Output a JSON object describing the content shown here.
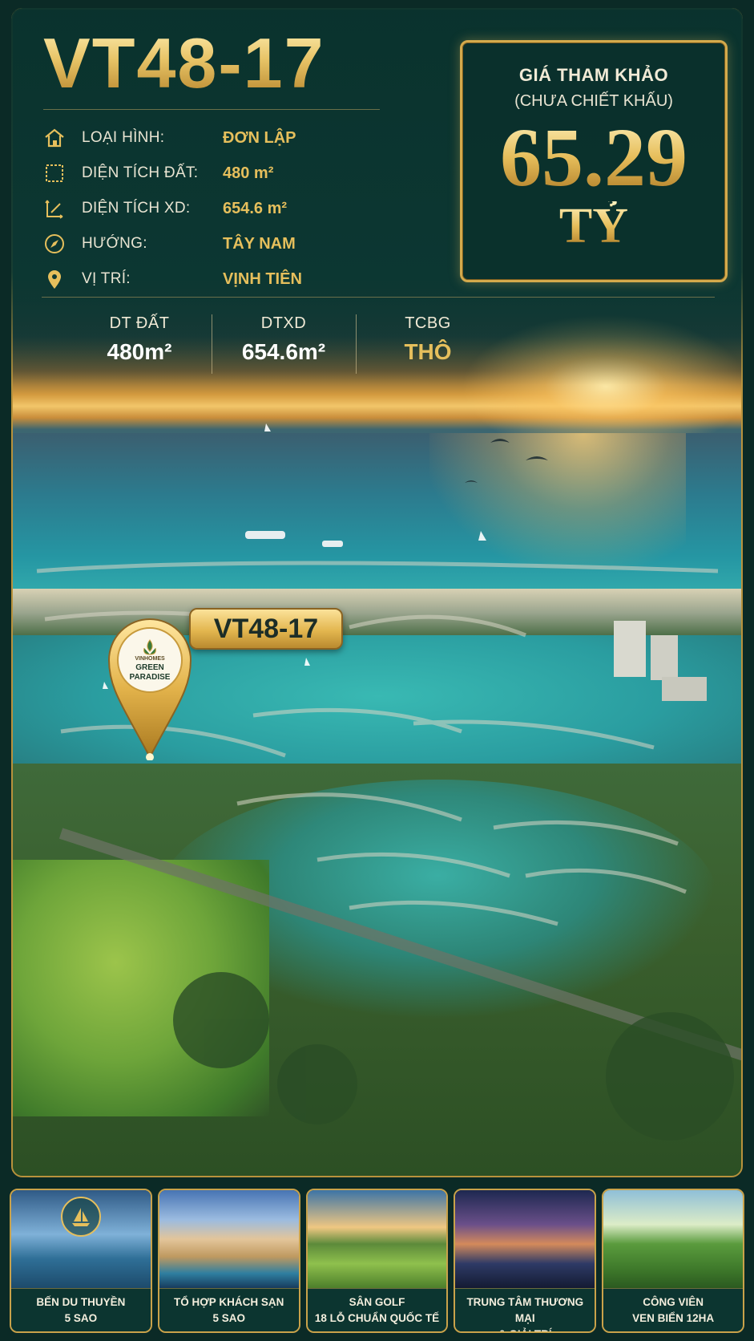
{
  "lot_code": "VT48-17",
  "specs": [
    {
      "icon": "house-icon",
      "label": "LOẠI HÌNH:",
      "value": "ĐƠN LẬP"
    },
    {
      "icon": "land-area-icon",
      "label": "DIỆN TÍCH ĐẤT:",
      "value": "480 m²"
    },
    {
      "icon": "floor-area-icon",
      "label": "DIỆN TÍCH XD:",
      "value": "654.6 m²"
    },
    {
      "icon": "compass-icon",
      "label": "HƯỚNG:",
      "value": "TÂY NAM"
    },
    {
      "icon": "location-pin-icon",
      "label": "VỊ TRÍ:",
      "value": "VỊNH TIÊN"
    }
  ],
  "price": {
    "label": "GIÁ THAM KHẢO",
    "note": "(CHƯA CHIẾT KHẤU)",
    "value": "65.29",
    "unit": "TỶ"
  },
  "stats": [
    {
      "label": "DT ĐẤT",
      "value": "480m²"
    },
    {
      "label": "DTXD",
      "value": "654.6m²"
    },
    {
      "label": "TCBG",
      "value": "THÔ"
    }
  ],
  "map": {
    "pin_logo_top": "VINHOMES",
    "pin_logo_line1": "GREEN",
    "pin_logo_line2": "PARADISE",
    "lot_label": "VT48-17"
  },
  "amenities": [
    {
      "line1": "BẾN DU THUYỀN",
      "line2": "5 SAO",
      "icon": "sailboat-icon"
    },
    {
      "line1": "TỔ HỢP KHÁCH SẠN",
      "line2": "5 SAO"
    },
    {
      "line1": "SÂN GOLF",
      "line2": "18 LỖ CHUẨN QUỐC TẾ"
    },
    {
      "line1": "TRUNG TÂM THƯƠNG MẠI",
      "line2": "& GIẢI TRÍ"
    },
    {
      "line1": "CÔNG VIÊN",
      "line2": "VEN BIỂN 12HA"
    }
  ],
  "colors": {
    "gold": "#e6bf5c",
    "panel": "#0e3a34",
    "border": "#c9a24a"
  }
}
